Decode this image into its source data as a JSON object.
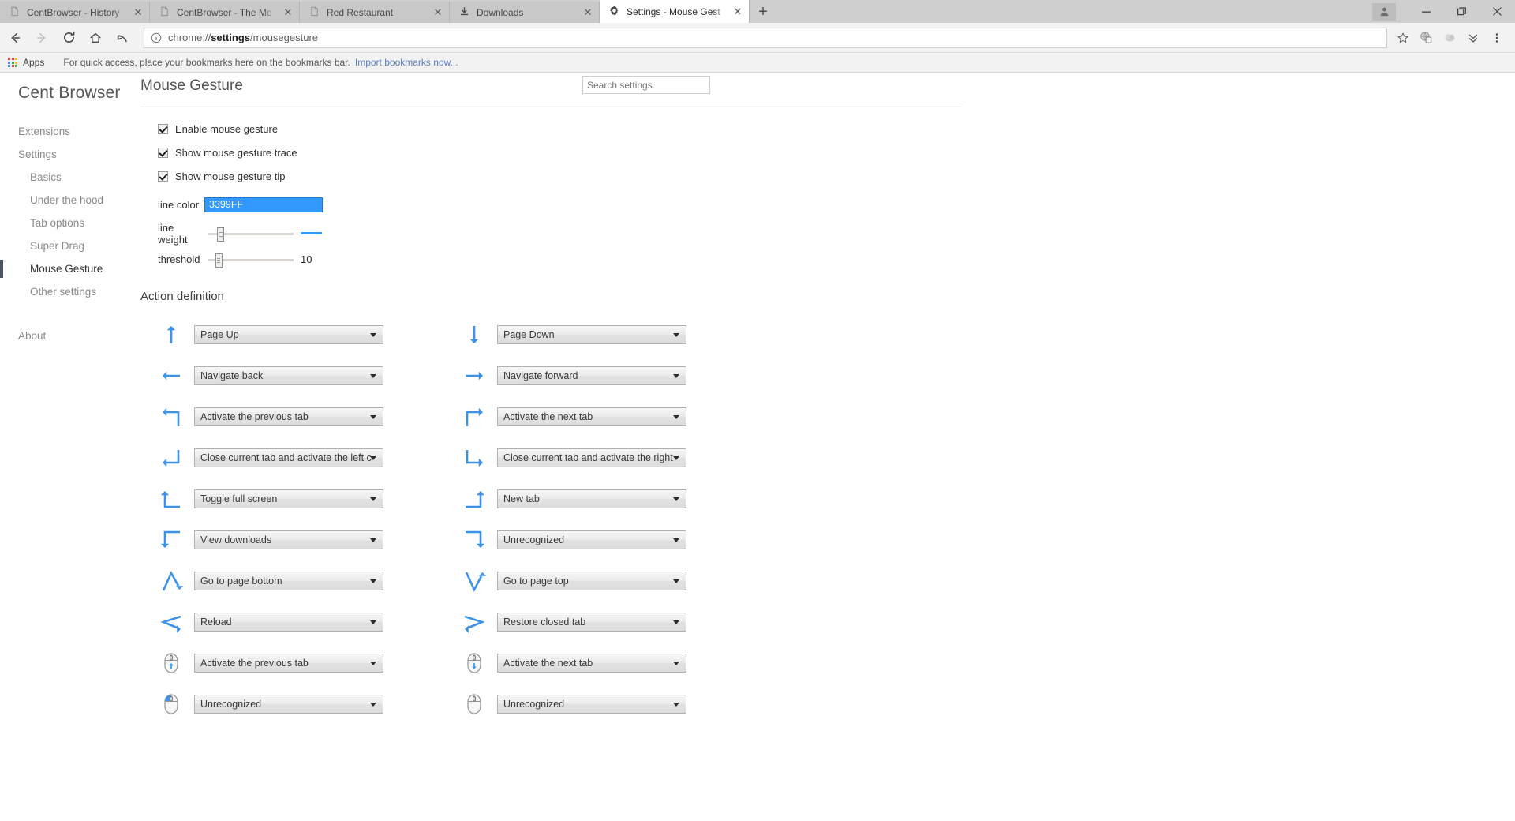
{
  "window": {
    "controls": {
      "avatar": "user-avatar",
      "minimize": "—",
      "maximize": "maximize",
      "close": "✕"
    }
  },
  "tabs": [
    {
      "title": "CentBrowser - History",
      "icon": "page-icon",
      "active": false,
      "close": "✕"
    },
    {
      "title": "CentBrowser - The Mo",
      "icon": "page-icon",
      "active": false,
      "close": "✕"
    },
    {
      "title": "Red Restaurant",
      "icon": "page-icon",
      "active": false,
      "close": "✕"
    },
    {
      "title": "Downloads",
      "icon": "download-icon",
      "active": false,
      "close": "✕"
    },
    {
      "title": "Settings - Mouse Gest",
      "icon": "gear-icon",
      "active": true,
      "close": "✕"
    }
  ],
  "newtab_label": "+",
  "toolbar": {
    "back": "←",
    "forward": "→",
    "reload": "⟳",
    "home": "⌂",
    "undo": "↰",
    "url_scheme": "chrome://",
    "url_bold": "settings",
    "url_rest": "/mousegesture",
    "url_full": "chrome://settings/mousegesture",
    "star": "☆",
    "ext1": "extension-icon",
    "ext2": "extension-icon",
    "chevrons": "chevron-double-down",
    "menu": "⋮"
  },
  "bookmark_bar": {
    "apps_label": "Apps",
    "hint": "For quick access, place your bookmarks here on the bookmarks bar.",
    "import_link": "Import bookmarks now...",
    "apps_dot_colors": [
      "#e8453c",
      "#e8453c",
      "#f9bb2d",
      "#4285f4",
      "#34a853",
      "#f9bb2d",
      "#4285f4",
      "#e8453c",
      "#34a853"
    ]
  },
  "sidebar": {
    "brand": "Cent Browser",
    "items": [
      {
        "label": "Extensions",
        "sub": false,
        "active": false
      },
      {
        "label": "Settings",
        "sub": false,
        "active": false
      },
      {
        "label": "Basics",
        "sub": true,
        "active": false
      },
      {
        "label": "Under the hood",
        "sub": true,
        "active": false
      },
      {
        "label": "Tab options",
        "sub": true,
        "active": false
      },
      {
        "label": "Super Drag",
        "sub": true,
        "active": false
      },
      {
        "label": "Mouse Gesture",
        "sub": true,
        "active": true
      },
      {
        "label": "Other settings",
        "sub": true,
        "active": false
      }
    ],
    "about": "About"
  },
  "content": {
    "page_title": "Mouse Gesture",
    "search_placeholder": "Search settings",
    "search_value": "",
    "checkboxes": [
      {
        "label": "Enable mouse gesture",
        "checked": true
      },
      {
        "label": "Show mouse gesture trace",
        "checked": true
      },
      {
        "label": "Show mouse gesture tip",
        "checked": true
      }
    ],
    "line_color": {
      "label": "line color",
      "value": "3399FF",
      "swatch": "#3399FF"
    },
    "line_weight": {
      "label": "line weight",
      "thumb_percent": 14,
      "preview_color": "#3399FF",
      "preview_thickness": 3
    },
    "threshold": {
      "label": "threshold",
      "thumb_percent": 12,
      "value": "10"
    },
    "action_title": "Action definition",
    "gesture_rows": [
      {
        "left": {
          "icon": "arrow-up",
          "action": "Page Up"
        },
        "right": {
          "icon": "arrow-down",
          "action": "Page Down"
        }
      },
      {
        "left": {
          "icon": "arrow-left",
          "action": "Navigate back"
        },
        "right": {
          "icon": "arrow-right",
          "action": "Navigate forward"
        }
      },
      {
        "left": {
          "icon": "arrow-up-then-left",
          "action": "Activate the previous tab"
        },
        "right": {
          "icon": "arrow-up-then-right",
          "action": "Activate the next tab"
        }
      },
      {
        "left": {
          "icon": "arrow-down-then-left",
          "action": "Close current tab and activate the left c"
        },
        "right": {
          "icon": "arrow-down-then-right",
          "action": "Close current tab and activate the right"
        }
      },
      {
        "left": {
          "icon": "arrow-left-then-up",
          "action": "Toggle full screen"
        },
        "right": {
          "icon": "arrow-right-then-up",
          "action": "New tab"
        }
      },
      {
        "left": {
          "icon": "arrow-right-then-down",
          "action": "View downloads"
        },
        "right": {
          "icon": "arrow-left-then-down",
          "action": "Unrecognized"
        }
      },
      {
        "left": {
          "icon": "arrow-up-down-zigzag",
          "action": "Go to page bottom"
        },
        "right": {
          "icon": "arrow-down-up-zigzag",
          "action": "Go to page top"
        }
      },
      {
        "left": {
          "icon": "arrow-left-right-zigzag",
          "action": "Reload"
        },
        "right": {
          "icon": "arrow-right-left-zigzag",
          "action": "Restore closed tab"
        }
      },
      {
        "left": {
          "icon": "mouse-wheel-up",
          "action": "Activate the previous tab"
        },
        "right": {
          "icon": "mouse-wheel-down",
          "action": "Activate the next tab"
        }
      },
      {
        "left": {
          "icon": "mouse-left-button",
          "action": "Unrecognized"
        },
        "right": {
          "icon": "mouse-plain",
          "action": "Unrecognized"
        }
      }
    ],
    "select_options": [
      "Page Up",
      "Page Down",
      "Navigate back",
      "Navigate forward",
      "Activate the previous tab",
      "Activate the next tab",
      "Close current tab and activate the left c",
      "Close current tab and activate the right",
      "Toggle full screen",
      "New tab",
      "View downloads",
      "Unrecognized",
      "Go to page bottom",
      "Go to page top",
      "Reload",
      "Restore closed tab"
    ]
  },
  "colors": {
    "accent_blue": "#3399FF",
    "gesture_arrow": "#3b92e8",
    "active_nav": "#4a5560"
  }
}
